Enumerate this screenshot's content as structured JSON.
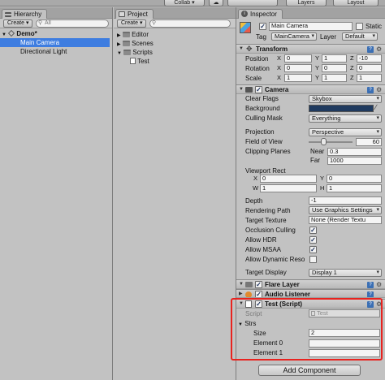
{
  "toolbar": {
    "collab": "Collab ▾",
    "cloud": "☁",
    "layers": "Layers",
    "layout": "Layout"
  },
  "hierarchy": {
    "tab": "Hierarchy",
    "create": "Create ▾",
    "search_placeholder": "All",
    "scene": "Demo*",
    "items": [
      "Main Camera",
      "Directional Light"
    ]
  },
  "project": {
    "tab": "Project",
    "create": "Create ▾",
    "folders": [
      "Editor",
      "Scenes",
      "Scripts"
    ],
    "files": [
      "Test"
    ]
  },
  "inspector": {
    "tab": "Inspector",
    "object_name": "Main Camera",
    "static_label": "Static",
    "tag_label": "Tag",
    "tag_value": "MainCamera",
    "layer_label": "Layer",
    "layer_value": "Default",
    "transform": {
      "title": "Transform",
      "rows": [
        {
          "label": "Position",
          "x": "0",
          "y": "1",
          "z": "-10"
        },
        {
          "label": "Rotation",
          "x": "0",
          "y": "0",
          "z": "0"
        },
        {
          "label": "Scale",
          "x": "1",
          "y": "1",
          "z": "1"
        }
      ]
    },
    "camera": {
      "title": "Camera",
      "clear_flags_label": "Clear Flags",
      "clear_flags": "Skybox",
      "background_label": "Background",
      "background_color": "#1f3a5f",
      "culling_label": "Culling Mask",
      "culling": "Everything",
      "projection_label": "Projection",
      "projection": "Perspective",
      "fov_label": "Field of View",
      "fov": "60",
      "fov_fraction": 0.33,
      "clipping_label": "Clipping Planes",
      "near_label": "Near",
      "near": "0.3",
      "far_label": "Far",
      "far": "1000",
      "viewport_label": "Viewport Rect",
      "vx": "0",
      "vy": "0",
      "vw": "1",
      "vh": "1",
      "depth_label": "Depth",
      "depth": "-1",
      "rendering_label": "Rendering Path",
      "rendering": "Use Graphics Settings",
      "target_texture_label": "Target Texture",
      "target_texture": "None (Render Textu",
      "occlusion_label": "Occlusion Culling",
      "hdr_label": "Allow HDR",
      "msaa_label": "Allow MSAA",
      "dynres_label": "Allow Dynamic Reso",
      "target_display_label": "Target Display",
      "target_display": "Display 1"
    },
    "flare_layer": "Flare Layer",
    "audio_listener": "Audio Listener",
    "test_script": {
      "title": "Test (Script)",
      "script_label": "Script",
      "script_value": "Test",
      "strs_label": "Strs",
      "size_label": "Size",
      "size": "2",
      "element0_label": "Element 0",
      "element1_label": "Element 1"
    },
    "add_component": "Add Component"
  },
  "colors": {
    "selection": "#3e7de0",
    "highlight_box": "#e8231f",
    "help_icon": "#3b6fb4"
  }
}
